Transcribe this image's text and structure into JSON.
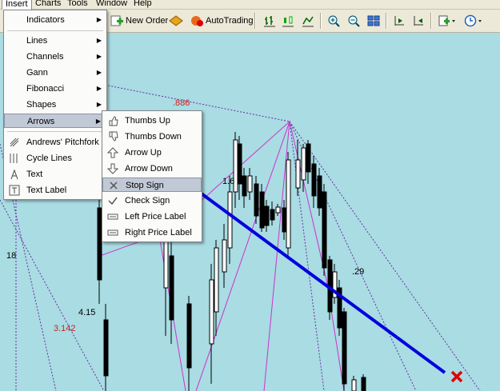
{
  "menubar": {
    "items": [
      {
        "label": "Insert",
        "active": true
      },
      {
        "label": "Charts",
        "active": false
      },
      {
        "label": "Tools",
        "active": false
      },
      {
        "label": "Window",
        "active": false
      },
      {
        "label": "Help",
        "active": false
      }
    ]
  },
  "toolbar": {
    "new_order": "New Order",
    "autotrading": "AutoTrading"
  },
  "insert_menu": {
    "items": [
      {
        "label": "Indicators",
        "submenu": true,
        "icon": ""
      },
      {
        "label": "Lines",
        "submenu": true,
        "icon": ""
      },
      {
        "label": "Channels",
        "submenu": true,
        "icon": ""
      },
      {
        "label": "Gann",
        "submenu": true,
        "icon": ""
      },
      {
        "label": "Fibonacci",
        "submenu": true,
        "icon": ""
      },
      {
        "label": "Shapes",
        "submenu": true,
        "icon": ""
      },
      {
        "label": "Arrows",
        "submenu": true,
        "icon": "",
        "highlighted": true
      },
      {
        "label": "Andrews' Pitchfork",
        "submenu": false,
        "icon": "pitchfork-icon"
      },
      {
        "label": "Cycle Lines",
        "submenu": false,
        "icon": "cycle-lines-icon"
      },
      {
        "label": "Text",
        "submenu": false,
        "icon": "text-icon"
      },
      {
        "label": "Text Label",
        "submenu": false,
        "icon": "text-label-icon"
      }
    ]
  },
  "arrows_menu": {
    "items": [
      {
        "label": "Thumbs Up",
        "icon": "thumbs-up-icon"
      },
      {
        "label": "Thumbs Down",
        "icon": "thumbs-down-icon"
      },
      {
        "label": "Arrow Up",
        "icon": "arrow-up-icon"
      },
      {
        "label": "Arrow Down",
        "icon": "arrow-down-icon"
      },
      {
        "label": "Stop Sign",
        "icon": "stop-sign-icon",
        "highlighted": true
      },
      {
        "label": "Check Sign",
        "icon": "check-sign-icon"
      },
      {
        "label": "Left Price Label",
        "icon": "left-price-label-icon"
      },
      {
        "label": "Right Price Label",
        "icon": "right-price-label-icon"
      }
    ]
  },
  "chart": {
    "background": "#a9dce3",
    "labels": {
      "fib_886": ".886",
      "fib_29": ".29",
      "fib_18": "18",
      "fib_415": "4.15",
      "fib_3142": "3.142",
      "fib_16": "1.6"
    },
    "trendline_color": "#0000dd",
    "stop_sign_color": "#e00000"
  }
}
